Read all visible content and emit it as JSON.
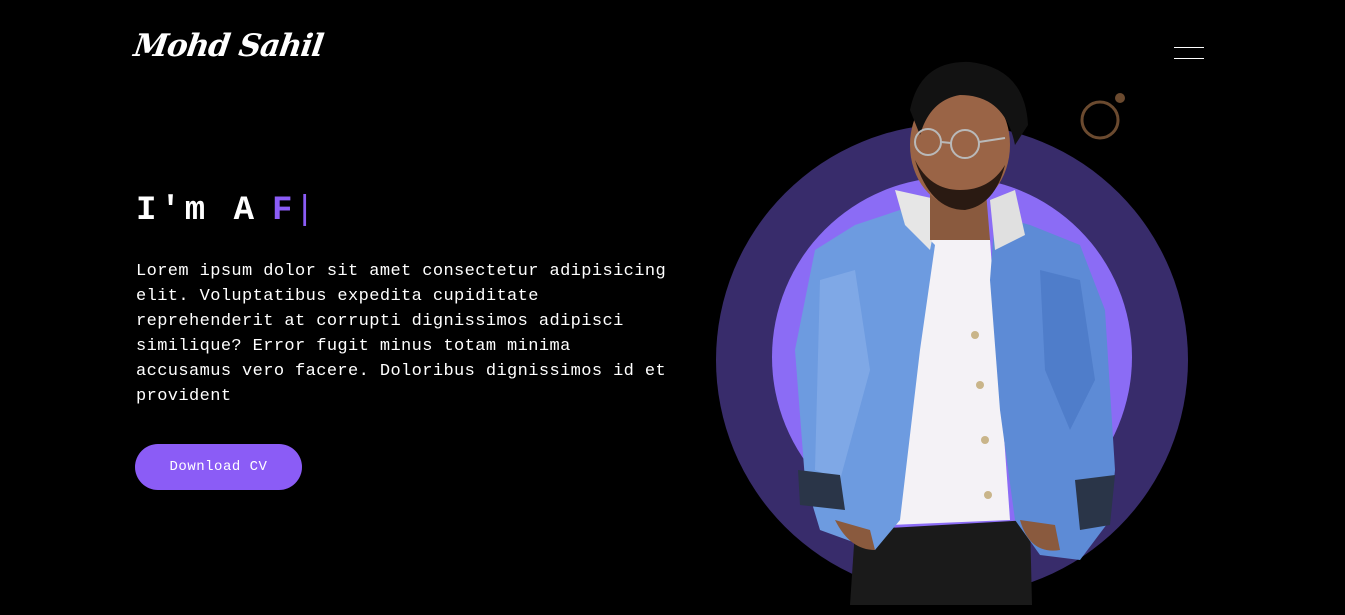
{
  "header": {
    "logo_text": "Mohd Sahil",
    "menu_icon": "hamburger-menu-icon"
  },
  "hero": {
    "headline_prefix": "I'm A",
    "headline_typed": "F",
    "headline_cursor": "|",
    "intro_text": "Lorem ipsum dolor sit amet consectetur adipisicing elit. Voluptatibus expedita cupiditate reprehenderit at corrupti dignissimos adipisci similique? Error fugit minus totam minima accusamus vero facere. Doloribus dignissimos id et provident",
    "cta_label": "Download CV"
  },
  "colors": {
    "background": "#000000",
    "accent": "#8b5cf6",
    "ring_outer": "#382c6b",
    "ring_inner": "#8b6cf5",
    "deco_ring": "#6b4a2f"
  }
}
